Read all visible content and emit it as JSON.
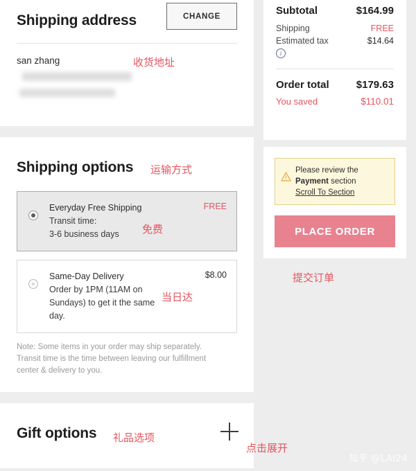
{
  "shipping_address": {
    "title": "Shipping address",
    "change_label": "CHANGE",
    "recipient": "san zhang",
    "annotation": "收货地址"
  },
  "shipping_options": {
    "title": "Shipping options",
    "annotation": "运输方式",
    "options": [
      {
        "name": "Everyday Free Shipping",
        "sub_line1": "Transit time:",
        "sub_line2": "3-6 business days",
        "price": "FREE",
        "price_is_free": true,
        "selected": true,
        "annotation": "免费"
      },
      {
        "name": "Same-Day Delivery",
        "sub_line1": "Order by 1PM (11AM on",
        "sub_line2": "Sundays) to get it the same",
        "sub_line3": "day.",
        "price": "$8.00",
        "price_is_free": false,
        "selected": false,
        "annotation": "当日达"
      }
    ],
    "note_line1": "Note: Some items in your order may ship separately.",
    "note_line2": "Transit time is the time between leaving our fulfillment",
    "note_line3": "center & delivery to you."
  },
  "gift_options": {
    "title": "Gift options",
    "annotation": "礼品选项",
    "expand_annotation": "点击展开",
    "expand_icon": "plus-icon"
  },
  "order_summary": {
    "subtotal_label": "Subtotal",
    "subtotal_value": "$164.99",
    "shipping_label": "Shipping",
    "shipping_value": "FREE",
    "tax_label": "Estimated tax",
    "tax_value": "$14.64",
    "tax_info_icon": "info-icon",
    "total_label": "Order total",
    "total_value": "$179.63",
    "saved_label": "You saved",
    "saved_value": "$110.01"
  },
  "actions": {
    "warning_icon": "warning-triangle-icon",
    "warning_line1": "Please review the",
    "warning_bold": "Payment",
    "warning_line2_tail": " section",
    "warning_link": "Scroll To Section",
    "place_order_label": "PLACE ORDER",
    "place_order_annotation": "提交订单"
  },
  "watermark": "知乎 @LAI24",
  "colors": {
    "accent_red": "#e2555f",
    "place_order_bg": "#e8828f",
    "warning_bg": "#fdf8dd",
    "warning_border": "#e0d08a",
    "page_bg": "#ededed"
  }
}
